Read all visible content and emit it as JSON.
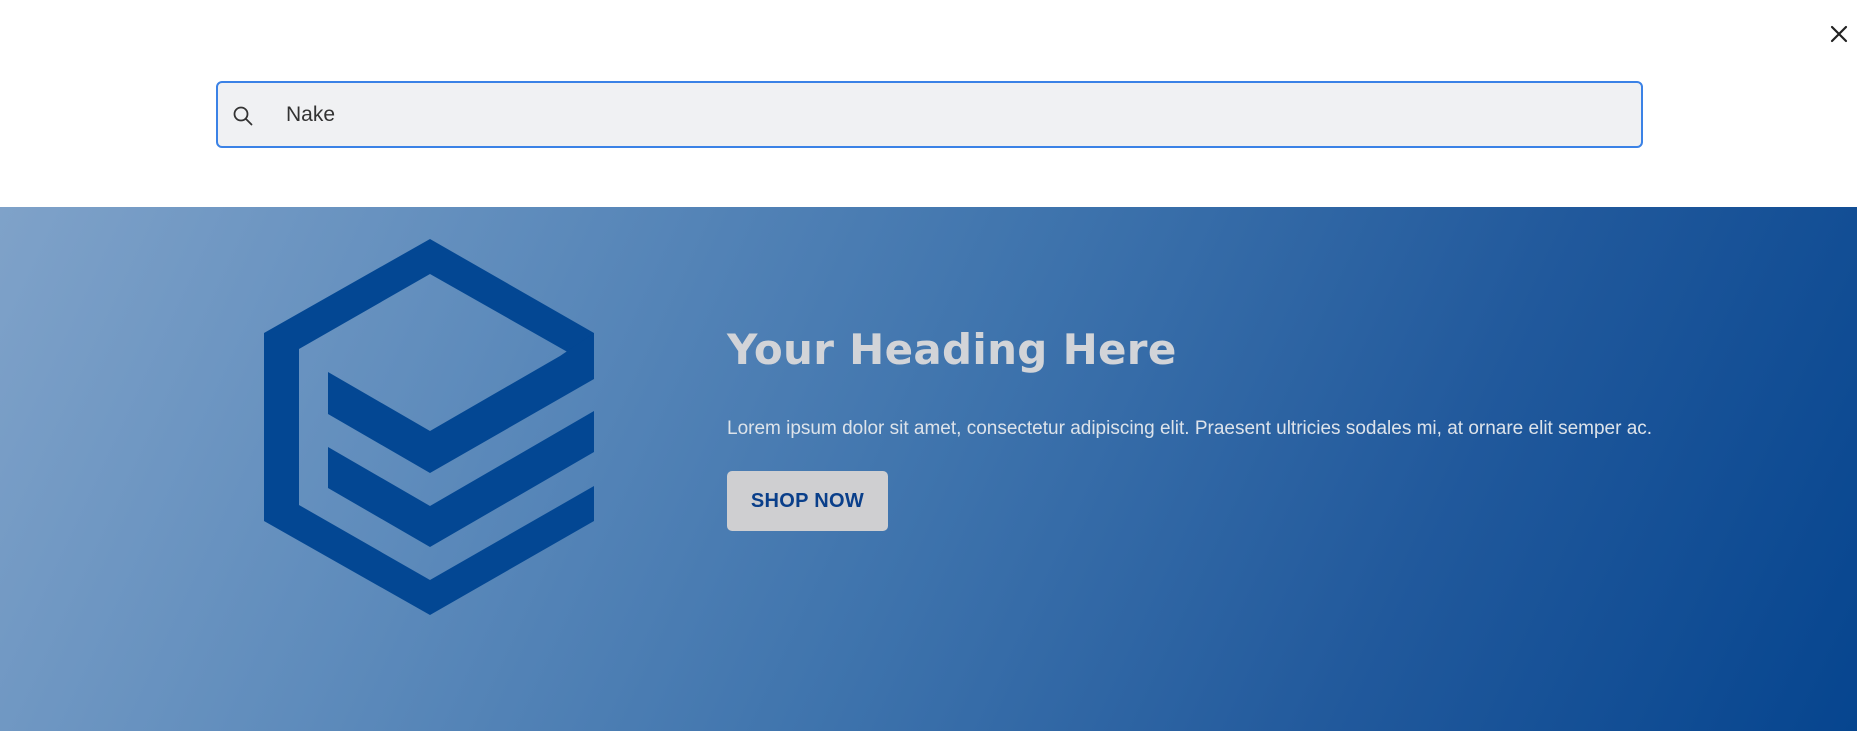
{
  "search": {
    "value": "Nake",
    "placeholder": ""
  },
  "hero": {
    "heading": "Your Heading Here",
    "text": "Lorem ipsum dolor sit amet, consectetur adipiscing elit. Praesent ultricies sodales mi, at ornare elit semper ac.",
    "button_label": "SHOP NOW"
  },
  "icons": {
    "close": "close-icon",
    "search": "search-icon",
    "logo": "hexagon-cube-logo"
  },
  "colors": {
    "search_border": "#3b82e6",
    "search_bg": "#f0f1f3",
    "hero_gradient_start": "#7fa2c9",
    "hero_gradient_end": "#06458f",
    "logo": "#034793",
    "heading": "#d2d4d8",
    "button_bg": "#cfcfd1",
    "button_text": "#0a3f8a"
  }
}
